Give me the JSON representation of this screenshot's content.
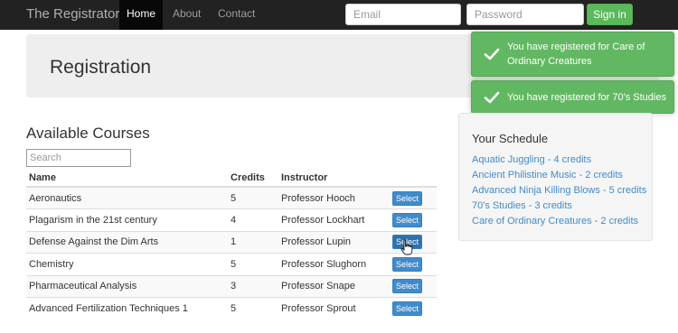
{
  "navbar": {
    "brand": "The Registrator",
    "items": [
      {
        "label": "Home",
        "active": true
      },
      {
        "label": "About"
      },
      {
        "label": "Contact"
      }
    ],
    "email_placeholder": "Email",
    "password_placeholder": "Password",
    "signin_label": "Sign in"
  },
  "jumbotron": {
    "title": "Registration"
  },
  "notifications": [
    {
      "text": "You have registered for Care of Ordinary Creatures",
      "icon": "check-icon"
    },
    {
      "text": "You have registered for 70's Studies",
      "icon": "check-icon"
    }
  ],
  "courses": {
    "title": "Available Courses",
    "search_placeholder": "Search",
    "columns": [
      "Name",
      "Credits",
      "Instructor"
    ],
    "select_label": "Select",
    "rows": [
      {
        "name": "Aeronautics",
        "credits": "5",
        "instructor": "Professor Hooch"
      },
      {
        "name": "Plagarism in the 21st century",
        "credits": "4",
        "instructor": "Professor Lockhart"
      },
      {
        "name": "Defense Against the Dim Arts",
        "credits": "1",
        "instructor": "Professor Lupin"
      },
      {
        "name": "Chemistry",
        "credits": "5",
        "instructor": "Professor Slughorn"
      },
      {
        "name": "Pharmaceutical Analysis",
        "credits": "3",
        "instructor": "Professor Snape"
      },
      {
        "name": "Advanced Fertilization Techniques 1",
        "credits": "5",
        "instructor": "Professor Sprout"
      }
    ]
  },
  "schedule": {
    "title": "Your Schedule",
    "items": [
      "Aquatic Juggling - 4 credits",
      "Ancient Philistine Music - 2 credits",
      "Advanced Ninja Killing Blows - 5 credits",
      "70's Studies - 3 credits",
      "Care of Ordinary Creatures - 2 credits"
    ]
  },
  "colors": {
    "navbar_bg": "#222222",
    "success": "#5cb85c",
    "primary": "#428bca",
    "link": "#428bca"
  }
}
